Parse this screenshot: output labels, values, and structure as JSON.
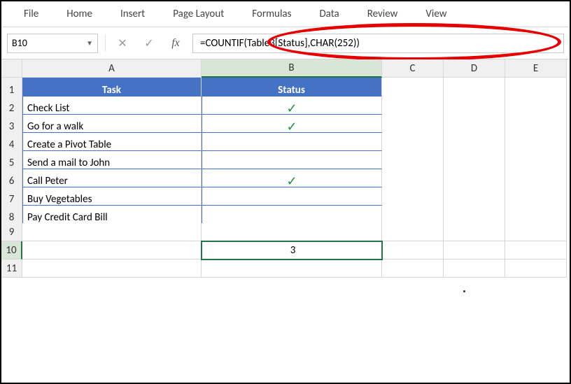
{
  "ribbon": {
    "tabs": [
      "File",
      "Home",
      "Insert",
      "Page Layout",
      "Formulas",
      "Data",
      "Review",
      "View"
    ]
  },
  "formulaBar": {
    "nameBox": "B10",
    "cancel": "✕",
    "enter": "✓",
    "fx": "fx",
    "formula": "=COUNTIF(Table3[Status],CHAR(252))"
  },
  "columns": [
    "A",
    "B",
    "C",
    "D",
    "E"
  ],
  "rows": [
    "1",
    "2",
    "3",
    "4",
    "5",
    "6",
    "7",
    "8",
    "9",
    "10",
    "11"
  ],
  "table": {
    "headers": {
      "task": "Task",
      "status": "Status"
    },
    "rows": [
      {
        "task": "Check List",
        "status": "✓"
      },
      {
        "task": "Go for a walk",
        "status": "✓"
      },
      {
        "task": "Create a Pivot Table",
        "status": ""
      },
      {
        "task": "Send a mail to John",
        "status": ""
      },
      {
        "task": "Call Peter",
        "status": "✓"
      },
      {
        "task": "Buy Vegetables",
        "status": ""
      },
      {
        "task": "Pay Credit Card Bill",
        "status": ""
      }
    ]
  },
  "result": {
    "value": "3"
  },
  "activeColumn": "B",
  "activeRow": "10"
}
